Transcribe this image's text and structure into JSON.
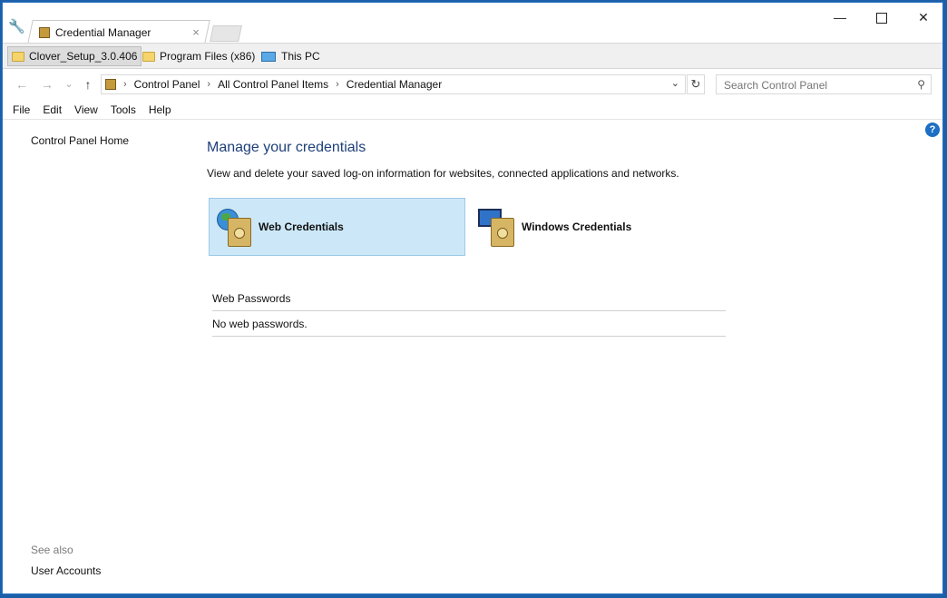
{
  "window": {
    "tab_title": "Credential Manager",
    "tab_close": "×",
    "minimize": "—",
    "close": "✕"
  },
  "favorites": [
    {
      "label": "Clover_Setup_3.0.406",
      "icon": "folder-icon"
    },
    {
      "label": "Program Files (x86)",
      "icon": "folder-icon"
    },
    {
      "label": "This PC",
      "icon": "computer-icon"
    }
  ],
  "navigation": {
    "back": "←",
    "forward": "→",
    "recent": "⌄",
    "up": "↑",
    "breadcrumb": [
      "Control Panel",
      "All Control Panel Items",
      "Credential Manager"
    ],
    "separator": "›",
    "dropdown": "⌄",
    "refresh": "↻",
    "search_placeholder": "Search Control Panel",
    "search_icon": "⚲"
  },
  "menu": [
    "File",
    "Edit",
    "View",
    "Tools",
    "Help"
  ],
  "sidebar": {
    "home": "Control Panel Home",
    "see_also": "See also",
    "user_accounts": "User Accounts"
  },
  "main": {
    "heading": "Manage your credentials",
    "description": "View and delete your saved log-on information for websites, connected applications and networks.",
    "web_credentials": "Web Credentials",
    "windows_credentials": "Windows Credentials",
    "section_title": "Web Passwords",
    "section_empty": "No web passwords.",
    "help": "?"
  },
  "colors": {
    "selected_bg": "#cce8f8",
    "heading": "#1e3f7a",
    "accent": "#1c6fc4"
  }
}
